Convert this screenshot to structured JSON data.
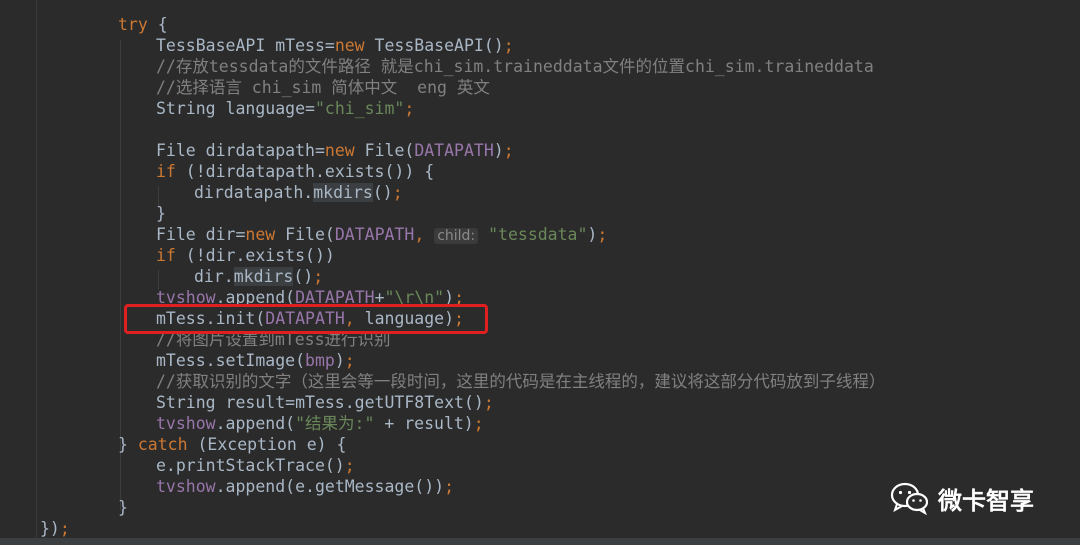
{
  "code_lines": [
    "try {",
    "TessBaseAPI mTess=new TessBaseAPI();",
    "//存放tessdata的文件路径 就是chi_sim.traineddata文件的位置chi_sim.traineddata",
    "//选择语言 chi_sim 简体中文  eng 英文",
    "String language=\"chi_sim\";",
    "",
    "File dirdatapath=new File(DATAPATH);",
    "if (!dirdatapath.exists()) {",
    "dirdatapath.mkdirs();",
    "}",
    "File dir=new File(DATAPATH, child: \"tessdata\");",
    "if (!dir.exists())",
    "dir.mkdirs();",
    "tvshow.append(DATAPATH+\"\\r\\n\");",
    "mTess.init(DATAPATH, language);",
    "//将图片设置到mTess进行识别",
    "mTess.setImage(bmp);",
    "//获取识别的文字（这里会等一段时间，这里的代码是在主线程的，建议将这部分代码放到子线程）",
    "String result=mTess.getUTF8Text();",
    "tvshow.append(\"结果为:\" + result);",
    "} catch (Exception e) {",
    "e.printStackTrace();",
    "tvshow.append(e.getMessage());",
    "}",
    "});"
  ],
  "param_hint": "child:",
  "highlighted_line": "mTess.init(DATAPATH, language);",
  "watermark": {
    "text": "微卡智享",
    "icon": "wechat-icon"
  },
  "colors": {
    "background": "#2b2b2b",
    "keyword": "#cc7832",
    "string": "#6a8759",
    "comment": "#808080",
    "field": "#9876aa",
    "default": "#a9b7c6",
    "highlight_box": "#e02020"
  }
}
